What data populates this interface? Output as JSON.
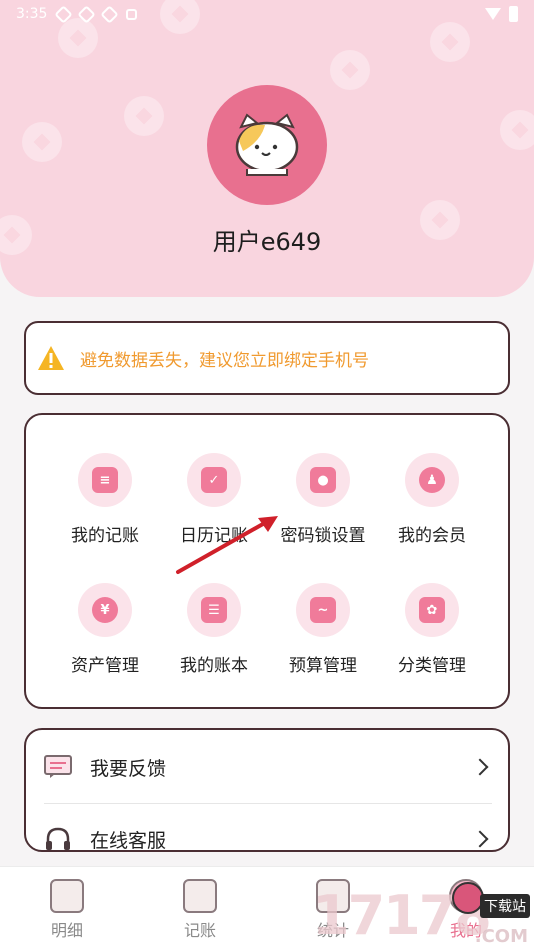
{
  "status_bar": {
    "time": "3:35"
  },
  "profile": {
    "username": "用户e649",
    "avatar_icon": "cat-avatar-icon"
  },
  "warning": {
    "text": "避免数据丢失，建议您立即绑定手机号",
    "color": "#f09a2f"
  },
  "grid": {
    "items": [
      {
        "label": "我的记账",
        "icon": "notebook-icon"
      },
      {
        "label": "日历记账",
        "icon": "calendar-check-icon"
      },
      {
        "label": "密码锁设置",
        "icon": "lock-icon"
      },
      {
        "label": "我的会员",
        "icon": "member-icon"
      },
      {
        "label": "资产管理",
        "icon": "yen-coin-icon"
      },
      {
        "label": "我的账本",
        "icon": "ledger-icon"
      },
      {
        "label": "预算管理",
        "icon": "budget-chart-icon"
      },
      {
        "label": "分类管理",
        "icon": "category-icon"
      }
    ]
  },
  "list": {
    "items": [
      {
        "label": "我要反馈",
        "icon": "feedback-icon"
      },
      {
        "label": "在线客服",
        "icon": "headset-icon"
      }
    ]
  },
  "tabs": [
    {
      "label": "明细",
      "icon": "detail-icon"
    },
    {
      "label": "记账",
      "icon": "bookkeeping-icon"
    },
    {
      "label": "统计",
      "icon": "statistics-icon"
    },
    {
      "label": "我的",
      "icon": "mine-icon"
    }
  ],
  "watermark": {
    "number": "17178",
    "badge": "下载站",
    "suffix": ".COM"
  },
  "colors": {
    "accent": "#e8708f",
    "header_bg": "#f9d5df",
    "icon_bg": "#fbe3ea",
    "icon_fg": "#f07b9a",
    "annotation_arrow": "#d0202a"
  }
}
